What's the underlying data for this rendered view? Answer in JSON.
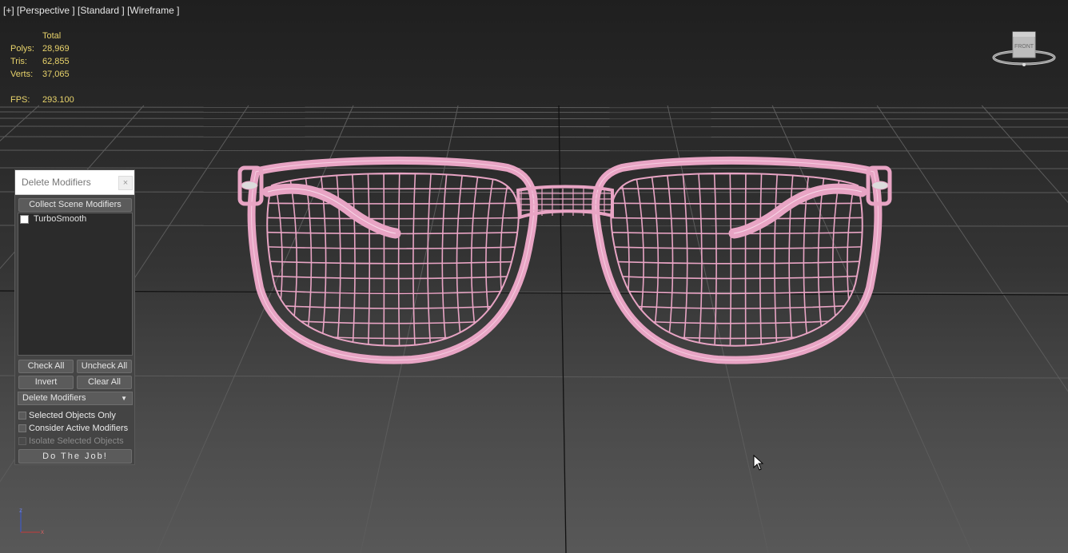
{
  "viewport": {
    "label": "[+] [Perspective ] [Standard ] [Wireframe ]",
    "stats": {
      "header": "Total",
      "polys_label": "Polys:",
      "polys": "28,969",
      "tris_label": "Tris:",
      "tris": "62,855",
      "verts_label": "Verts:",
      "verts": "37,065",
      "fps_label": "FPS:",
      "fps": "293.100"
    },
    "viewcube_label": "FRONT",
    "wire_color": "#e8a4c4",
    "axis": {
      "z": "z",
      "x": "x"
    }
  },
  "dialog": {
    "title": "Delete Modifiers",
    "close": "×",
    "collect_button": "Collect Scene Modifiers",
    "modifiers": [
      {
        "label": "TurboSmooth",
        "checked": false
      }
    ],
    "check_all": "Check All",
    "uncheck_all": "Uncheck All",
    "invert": "Invert",
    "clear_all": "Clear All",
    "mode_dropdown": "Delete Modifiers",
    "options": {
      "selected_only": "Selected Objects Only",
      "consider_active": "Consider Active Modifiers",
      "isolate_selected": "Isolate Selected Objects"
    },
    "do_job": "Do The Job!"
  }
}
